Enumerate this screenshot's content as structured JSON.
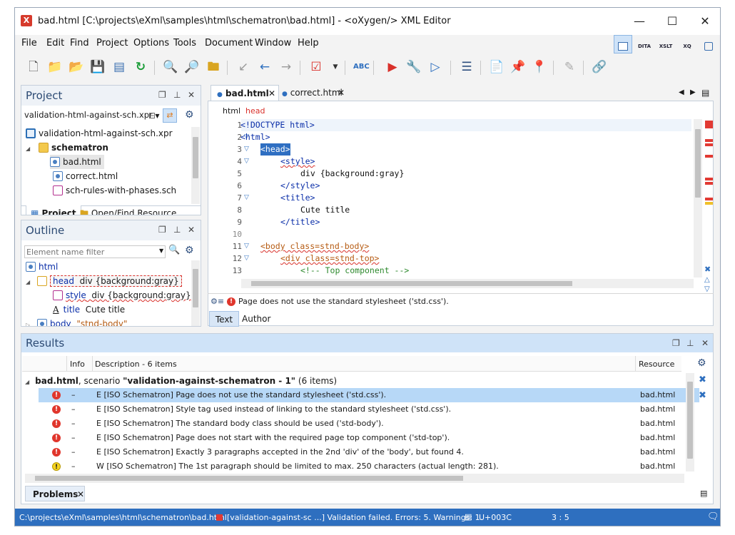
{
  "window": {
    "title": "bad.html [C:\\projects\\eXml\\samples\\html\\schematron\\bad.html] - <oXygen/> XML Editor",
    "controls": [
      "minimize",
      "maximize",
      "close"
    ]
  },
  "menu": [
    "File",
    "Edit",
    "Find",
    "Project",
    "Options",
    "Tools",
    "Document",
    "Window",
    "Help"
  ],
  "perspectives": [
    {
      "name": "editor",
      "label": ""
    },
    {
      "name": "dita",
      "label": "DITA"
    },
    {
      "name": "xslt",
      "label": "XSLT"
    },
    {
      "name": "xq",
      "label": "XQ"
    },
    {
      "name": "db",
      "label": ""
    }
  ],
  "toolbar_icons": [
    "new-icon",
    "open-icon",
    "open-url-icon",
    "save-icon",
    "save-all-icon",
    "reload-icon",
    "find-icon",
    "find-in-files-icon",
    "open-resource-icon",
    "back-icon",
    "forward-icon",
    "forward-arrow-icon",
    "validate-icon",
    "validate-dropdown-icon",
    "spellcheck-icon",
    "apply-scenario-icon",
    "configure-scenario-icon",
    "debug-scenario-icon",
    "format-indent-icon",
    "pin-icon",
    "bookmark-icon",
    "next-bookmark-icon",
    "edit-icon",
    "link-icon"
  ],
  "project": {
    "title": "Project",
    "selector": "validation-html-against-sch.xpr",
    "items": [
      {
        "label": "validation-html-against-sch.xpr",
        "icon": "xpr-file-icon",
        "level": 0
      },
      {
        "label": "schematron",
        "icon": "folder-icon",
        "level": 1,
        "bold": true
      },
      {
        "label": "bad.html",
        "icon": "html-file-icon",
        "level": 2,
        "selected": true
      },
      {
        "label": "correct.html",
        "icon": "html-file-icon",
        "level": 2
      },
      {
        "label": "sch-rules-with-phases.sch",
        "icon": "sch-file-icon",
        "level": 2
      }
    ],
    "tabs": [
      "Project",
      "Open/Find Resource"
    ]
  },
  "outline": {
    "title": "Outline",
    "filter_placeholder": "Element name filter",
    "items": [
      {
        "name": "html",
        "detail": ""
      },
      {
        "name": "head",
        "detail": "div {background:gray}"
      },
      {
        "name": "style",
        "detail": "div {background:gray}"
      },
      {
        "name": "title",
        "detail": "Cute title"
      },
      {
        "name": "body",
        "detail": "\"stnd-body\""
      }
    ]
  },
  "editor": {
    "tabs": [
      {
        "label": "bad.html",
        "active": true
      },
      {
        "label": "correct.html",
        "active": false
      }
    ],
    "breadcrumb": [
      "html",
      "head"
    ],
    "lines": [
      {
        "n": "1",
        "text": "<!DOCTYPE html>"
      },
      {
        "n": "2",
        "text": "<html>"
      },
      {
        "n": "3",
        "text": "<head>"
      },
      {
        "n": "4",
        "text": "<style>"
      },
      {
        "n": "5",
        "text": "div {background:gray}"
      },
      {
        "n": "6",
        "text": "</style>"
      },
      {
        "n": "7",
        "text": "<title>"
      },
      {
        "n": "8",
        "text": "Cute title"
      },
      {
        "n": "9",
        "text": "</title>"
      },
      {
        "n": "10",
        "text": ""
      },
      {
        "n": "11",
        "text": "<body class=stnd-body>"
      },
      {
        "n": "12",
        "text": "<div class=stnd-top>"
      },
      {
        "n": "13",
        "text": "<!-- Top component -->"
      }
    ],
    "message": "Page does not use the standard stylesheet ('std.css').",
    "mode_tabs": [
      "Text",
      "Author"
    ]
  },
  "results": {
    "title": "Results",
    "columns": [
      "Info",
      "Description - 6 items",
      "Resource"
    ],
    "group": {
      "file": "bad.html",
      "mid": ", scenario ",
      "scenario": "\"validation-against-schematron - 1\"",
      "count": "(6 items)"
    },
    "rows": [
      {
        "type": "error",
        "dash": "–",
        "desc": "E [ISO Schematron] Page does not use the standard stylesheet ('std.css').",
        "resource": "bad.html",
        "selected": true
      },
      {
        "type": "error",
        "dash": "–",
        "desc": "E [ISO Schematron] Style tag used instead of linking to the standard stylesheet ('std.css').",
        "resource": "bad.html"
      },
      {
        "type": "error",
        "dash": "–",
        "desc": "E [ISO Schematron] The standard body class should be used ('std-body').",
        "resource": "bad.html"
      },
      {
        "type": "error",
        "dash": "–",
        "desc": "E [ISO Schematron] Page does not start with the required page top component ('std-top').",
        "resource": "bad.html"
      },
      {
        "type": "error",
        "dash": "–",
        "desc": "E [ISO Schematron] Exactly 3 paragraphs accepted in the 2nd 'div' of the 'body', but found 4.",
        "resource": "bad.html"
      },
      {
        "type": "warning",
        "dash": "–",
        "desc": "W [ISO Schematron] The 1st paragraph should be limited to max. 250 characters (actual length: 281).",
        "resource": "bad.html"
      }
    ],
    "bottom_tab": "Problems"
  },
  "status": {
    "path": "C:\\projects\\eXml\\samples\\html\\schematron\\bad.html",
    "validation": "[validation-against-sc ...] Validation failed. Errors: 5. Warnings: 1.",
    "unicode": "U+003C",
    "position": "3 : 5"
  },
  "colors": {
    "accent": "#2e6fbf",
    "error": "#e0362c",
    "warning": "#f4d21f",
    "selection": "#b7d8f7"
  }
}
